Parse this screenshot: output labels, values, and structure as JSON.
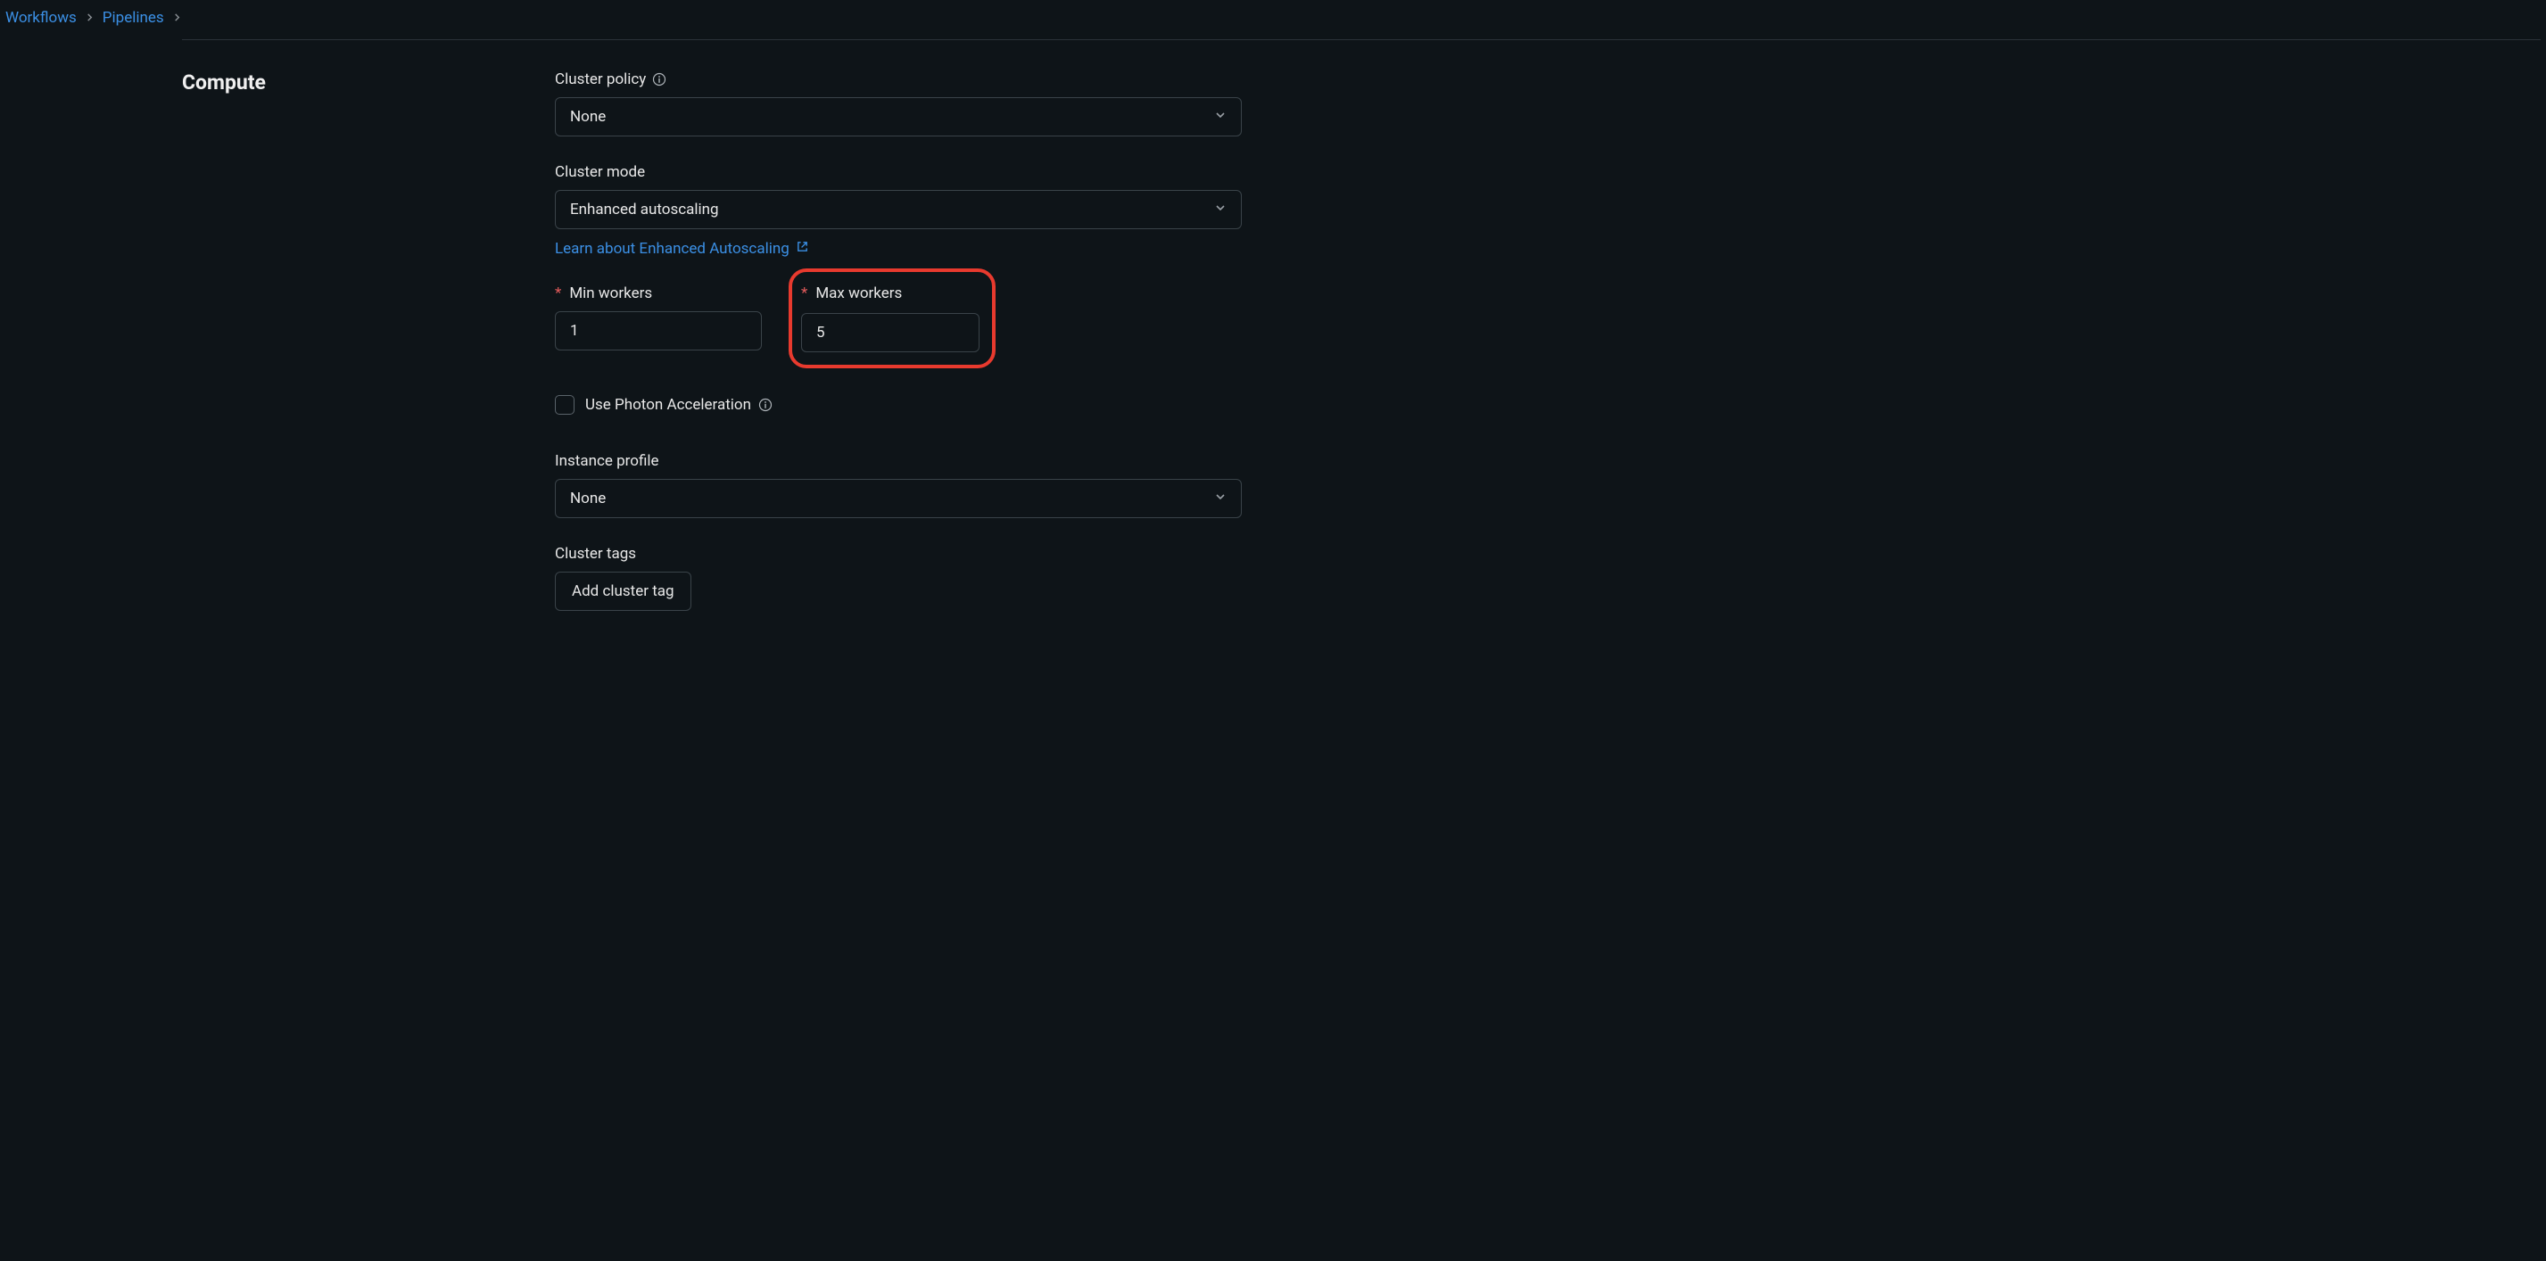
{
  "breadcrumb": {
    "items": [
      {
        "label": "Workflows"
      },
      {
        "label": "Pipelines"
      }
    ]
  },
  "section": {
    "title": "Compute"
  },
  "fields": {
    "cluster_policy": {
      "label": "Cluster policy",
      "value": "None"
    },
    "cluster_mode": {
      "label": "Cluster mode",
      "value": "Enhanced autoscaling",
      "link_text": "Learn about Enhanced Autoscaling"
    },
    "min_workers": {
      "label": "Min workers",
      "value": "1"
    },
    "max_workers": {
      "label": "Max workers",
      "value": "5"
    },
    "photon": {
      "label": "Use Photon Acceleration"
    },
    "instance_profile": {
      "label": "Instance profile",
      "value": "None"
    },
    "cluster_tags": {
      "label": "Cluster tags",
      "button": "Add cluster tag"
    }
  }
}
